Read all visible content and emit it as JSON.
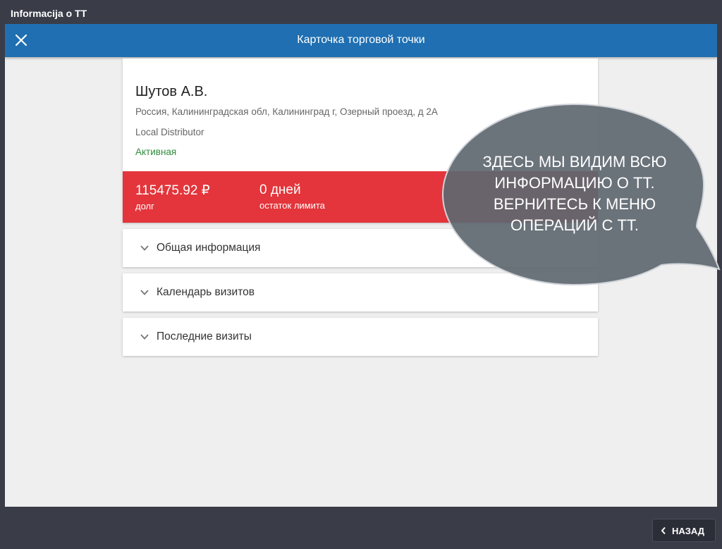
{
  "window": {
    "title": "Informacija o TT"
  },
  "app_bar": {
    "title": "Карточка торговой точки"
  },
  "outlet": {
    "name": "Шутов А.В.",
    "address": "Россия, Калининградская обл, Калининград г, Озерный проезд, д 2А",
    "type": "Local Distributor",
    "status": "Активная"
  },
  "metrics": {
    "debt_value": "115475.92 ₽",
    "debt_label": "долг",
    "limit_value": "0 дней",
    "limit_label": "остаток лимита"
  },
  "sections": [
    {
      "label": "Общая информация"
    },
    {
      "label": "Календарь визитов"
    },
    {
      "label": "Последние визиты"
    }
  ],
  "callout": {
    "lines": [
      "ЗДЕСЬ МЫ ВИДИМ ВСЮ",
      "ИНФОРМАЦИЮ О ТТ.",
      "ВЕРНИТЕСЬ К МЕНЮ",
      "ОПЕРАЦИЙ С ТТ."
    ]
  },
  "footer": {
    "back_label": "НАЗАД"
  },
  "colors": {
    "app_bar": "#1f6fb2",
    "debt_band": "#e3353b",
    "status_active": "#2e8b3d",
    "callout_bubble": "#5e6770"
  },
  "icons": {
    "close": "close-icon",
    "chevron": "chevron-down-icon",
    "back": "chevron-left-icon"
  }
}
